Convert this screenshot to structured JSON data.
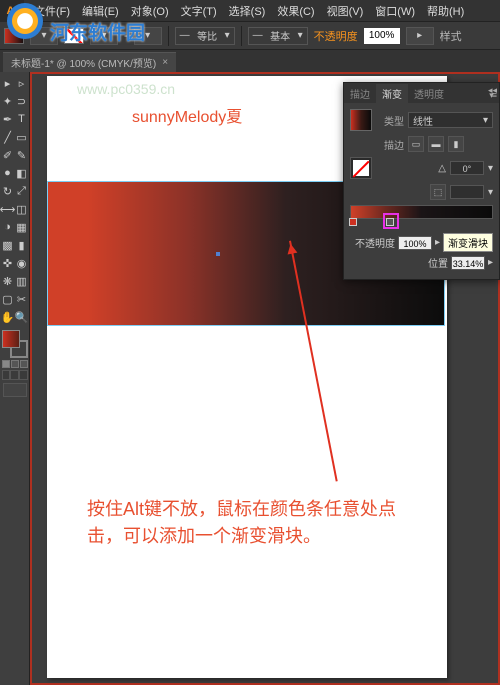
{
  "menubar": {
    "items": [
      "文件(F)",
      "编辑(E)",
      "对象(O)",
      "文字(T)",
      "选择(S)",
      "效果(C)",
      "视图(V)",
      "窗口(W)",
      "帮助(H)"
    ]
  },
  "toolbar": {
    "stroke_label": "-",
    "weight": "等比",
    "style": "基本",
    "opacity_label": "不透明度",
    "opacity_value": "100%",
    "prefs": "样式"
  },
  "doc_tab": {
    "title": "未标题-1* @ 100% (CMYK/预览)"
  },
  "watermark": {
    "site": "www.pc0359.cn",
    "author": "sunnyMelody夏",
    "brand": "河东软件园"
  },
  "instruction": "按住Alt键不放，鼠标在颜色条任意处点击，可以添加一个渐变滑块。",
  "panel": {
    "tabs": [
      "描边",
      "渐变",
      "透明度"
    ],
    "type_label": "类型",
    "type_value": "线性",
    "stroke_label": "描边",
    "angle_value": "0°",
    "opacity_label": "不透明度",
    "opacity_value": "100%",
    "location_label": "位置",
    "location_value": "33.14%",
    "tooltip": "渐变滑块"
  }
}
